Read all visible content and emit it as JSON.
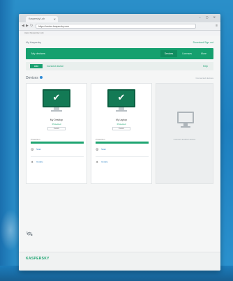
{
  "browser": {
    "tab_title": "Kaspersky Lab",
    "tab_close": "✕",
    "window_controls": "– ▢ ✕",
    "back": "◀",
    "forward": "▶",
    "reload": "↻",
    "url": "https://center.kaspersky.com",
    "bookmarks": "Apps   Kaspersky Lab",
    "menu": "≡"
  },
  "header": {
    "topline": "My Kaspersky",
    "toplinks": "Download   Sign out",
    "banner_title": "My devices",
    "tabs": [
      {
        "label": "Devices",
        "active": true
      },
      {
        "label": "Licenses",
        "active": false
      },
      {
        "label": "More",
        "active": false
      }
    ]
  },
  "subbar": {
    "button": "Add",
    "link": "Connect device",
    "right": "Help"
  },
  "section": {
    "title": "Devices",
    "actions": "Connected devices"
  },
  "devices": [
    {
      "name": "My Desktop",
      "status": "Protected",
      "button": "Details",
      "bar_label": "Protection",
      "progress": 1.0,
      "row1": "Scan",
      "row2": "Update"
    },
    {
      "name": "My Laptop",
      "status": "Protected",
      "button": "Details",
      "bar_label": "Protection",
      "progress": 1.0,
      "row1": "Scan",
      "row2": "Update"
    }
  ],
  "empty_slot": {
    "text": "Connect another device"
  },
  "footer_note": "",
  "footer": {
    "brand": "KASPERSKY",
    "copyright": "",
    "links": ""
  },
  "colors": {
    "accent": "#15a06e",
    "link": "#2a7fc1",
    "background": "#2a8fc9"
  },
  "icons": {
    "device_icon": "monitor-check-icon",
    "empty_icon": "monitor-icon",
    "note_icon": "satellite-icon"
  }
}
